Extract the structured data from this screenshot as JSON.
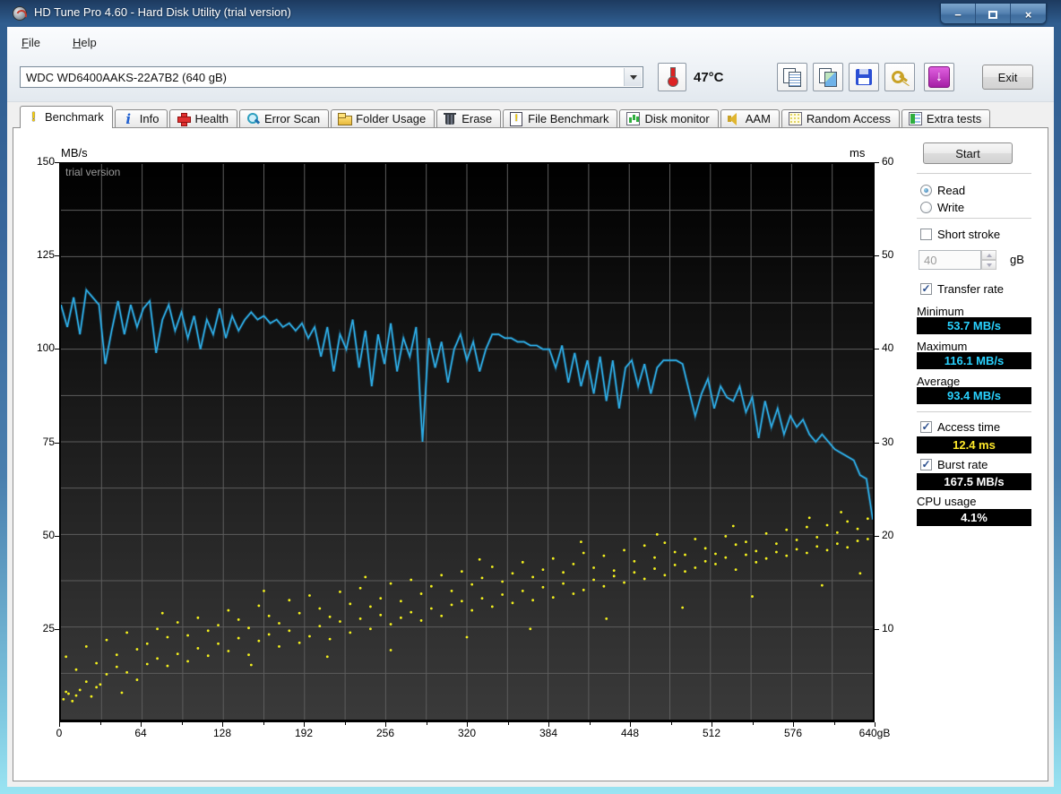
{
  "window": {
    "title": "HD Tune Pro 4.60 - Hard Disk Utility (trial version)",
    "minimize": "−",
    "close": "×"
  },
  "menu": {
    "items": [
      "File",
      "Help"
    ]
  },
  "toolbar": {
    "drive_selector": "WDC WD6400AAKS-22A7B2 (640 gB)",
    "temperature": "47°C",
    "exit_label": "Exit"
  },
  "tabs": [
    {
      "label": "Benchmark",
      "icon": "benchmark-icon",
      "active": true
    },
    {
      "label": "Info",
      "icon": "info-icon",
      "active": false
    },
    {
      "label": "Health",
      "icon": "health-icon",
      "active": false
    },
    {
      "label": "Error Scan",
      "icon": "error-scan-icon",
      "active": false
    },
    {
      "label": "Folder Usage",
      "icon": "folder-usage-icon",
      "active": false
    },
    {
      "label": "Erase",
      "icon": "erase-icon",
      "active": false
    },
    {
      "label": "File Benchmark",
      "icon": "file-benchmark-icon",
      "active": false
    },
    {
      "label": "Disk monitor",
      "icon": "disk-monitor-icon",
      "active": false
    },
    {
      "label": "AAM",
      "icon": "aam-icon",
      "active": false
    },
    {
      "label": "Random Access",
      "icon": "random-access-icon",
      "active": false
    },
    {
      "label": "Extra tests",
      "icon": "extra-tests-icon",
      "active": false
    }
  ],
  "benchmark": {
    "start_label": "Start",
    "read_label": "Read",
    "write_label": "Write",
    "selected_mode": "Read",
    "short_stroke": {
      "label": "Short stroke",
      "checked": false,
      "value": "40",
      "unit": "gB"
    },
    "transfer_rate": {
      "label": "Transfer rate",
      "checked": true,
      "minimum_label": "Minimum",
      "minimum": "53.7 MB/s",
      "maximum_label": "Maximum",
      "maximum": "116.1 MB/s",
      "average_label": "Average",
      "average": "93.4 MB/s"
    },
    "access_time": {
      "label": "Access time",
      "checked": true,
      "value": "12.4 ms"
    },
    "burst_rate": {
      "label": "Burst rate",
      "checked": true,
      "value": "167.5 MB/s"
    },
    "cpu_usage": {
      "label": "CPU usage",
      "value": "4.1%"
    }
  },
  "chart_data": {
    "type": "line",
    "watermark": "trial version",
    "left_axis": {
      "label": "MB/s",
      "range": [
        0,
        150
      ],
      "ticks": [
        150,
        125,
        100,
        75,
        50,
        25
      ],
      "grid_step": 12.5
    },
    "right_axis": {
      "label": "ms",
      "range": [
        0,
        60
      ],
      "ticks": [
        60,
        50,
        40,
        30,
        20,
        10
      ]
    },
    "x_axis": {
      "range": [
        0,
        640
      ],
      "ticks": [
        0,
        64,
        128,
        192,
        256,
        320,
        384,
        448,
        512,
        576,
        640
      ],
      "last_tick_suffix": "gB",
      "grid_step": 32
    },
    "series": [
      {
        "name": "transfer_rate",
        "type": "line",
        "axis": "left",
        "color": "#2da8e0",
        "x_start": 0,
        "x_step": 5,
        "values": [
          112,
          106,
          114,
          104,
          116,
          114,
          112,
          96,
          105,
          113,
          104,
          112,
          106,
          111,
          113,
          99,
          108,
          112,
          105,
          110,
          103,
          109,
          100,
          108,
          104,
          111,
          103,
          109,
          105,
          108,
          110,
          108,
          109,
          107,
          108,
          106,
          107,
          105,
          107,
          103,
          106,
          98,
          106,
          94,
          104,
          100,
          108,
          95,
          105,
          90,
          104,
          96,
          107,
          94,
          103,
          98,
          106,
          75,
          103,
          95,
          102,
          91,
          100,
          104,
          97,
          102,
          94,
          100,
          104,
          104,
          103,
          103,
          102,
          102,
          101,
          101,
          100,
          100,
          95,
          101,
          91,
          99,
          90,
          97,
          88,
          98,
          86,
          97,
          84,
          95,
          97,
          90,
          96,
          88,
          95,
          97,
          97,
          97,
          96,
          89,
          82,
          88,
          92,
          84,
          90,
          87,
          86,
          90,
          83,
          87,
          76,
          86,
          79,
          84,
          77,
          82,
          79,
          81,
          77,
          75,
          77,
          75,
          73,
          72,
          71,
          70,
          66,
          65,
          54
        ]
      },
      {
        "name": "access_time",
        "type": "scatter",
        "axis": "right",
        "color": "#f2ef1d",
        "points": [
          [
            2,
            2.2
          ],
          [
            4,
            6.8
          ],
          [
            4,
            3.0
          ],
          [
            6,
            2.8
          ],
          [
            9,
            2.0
          ],
          [
            12,
            5.4
          ],
          [
            12,
            2.6
          ],
          [
            15,
            3.2
          ],
          [
            20,
            7.9
          ],
          [
            20,
            4.1
          ],
          [
            24,
            2.5
          ],
          [
            28,
            6.1
          ],
          [
            28,
            3.5
          ],
          [
            31,
            3.8
          ],
          [
            36,
            8.6
          ],
          [
            36,
            4.9
          ],
          [
            44,
            7.0
          ],
          [
            44,
            5.7
          ],
          [
            48,
            2.9
          ],
          [
            52,
            9.4
          ],
          [
            52,
            5.1
          ],
          [
            60,
            7.6
          ],
          [
            60,
            4.3
          ],
          [
            68,
            8.2
          ],
          [
            68,
            6.0
          ],
          [
            76,
            9.8
          ],
          [
            76,
            6.6
          ],
          [
            80,
            11.5
          ],
          [
            84,
            8.9
          ],
          [
            84,
            5.8
          ],
          [
            92,
            10.5
          ],
          [
            92,
            7.1
          ],
          [
            100,
            9.1
          ],
          [
            100,
            6.3
          ],
          [
            108,
            11.0
          ],
          [
            108,
            7.7
          ],
          [
            116,
            9.6
          ],
          [
            116,
            6.9
          ],
          [
            124,
            10.2
          ],
          [
            124,
            8.2
          ],
          [
            132,
            11.8
          ],
          [
            132,
            7.4
          ],
          [
            140,
            10.8
          ],
          [
            140,
            8.8
          ],
          [
            148,
            9.9
          ],
          [
            148,
            7.0
          ],
          [
            150,
            5.9
          ],
          [
            156,
            12.3
          ],
          [
            156,
            8.5
          ],
          [
            160,
            13.9
          ],
          [
            164,
            11.2
          ],
          [
            164,
            9.2
          ],
          [
            172,
            10.4
          ],
          [
            172,
            7.9
          ],
          [
            180,
            12.9
          ],
          [
            180,
            9.6
          ],
          [
            188,
            11.5
          ],
          [
            188,
            8.3
          ],
          [
            196,
            13.4
          ],
          [
            196,
            9.0
          ],
          [
            204,
            12.0
          ],
          [
            204,
            10.1
          ],
          [
            210,
            6.8
          ],
          [
            212,
            11.1
          ],
          [
            212,
            8.7
          ],
          [
            220,
            13.8
          ],
          [
            220,
            10.6
          ],
          [
            228,
            12.5
          ],
          [
            228,
            9.4
          ],
          [
            236,
            14.2
          ],
          [
            236,
            10.9
          ],
          [
            240,
            15.4
          ],
          [
            244,
            12.2
          ],
          [
            244,
            9.8
          ],
          [
            252,
            13.1
          ],
          [
            252,
            11.3
          ],
          [
            260,
            14.7
          ],
          [
            260,
            10.3
          ],
          [
            260,
            7.5
          ],
          [
            268,
            12.8
          ],
          [
            268,
            11.0
          ],
          [
            276,
            15.1
          ],
          [
            276,
            11.6
          ],
          [
            284,
            13.6
          ],
          [
            284,
            10.7
          ],
          [
            292,
            14.4
          ],
          [
            292,
            12.0
          ],
          [
            300,
            15.6
          ],
          [
            300,
            11.2
          ],
          [
            308,
            13.9
          ],
          [
            308,
            12.4
          ],
          [
            316,
            16.0
          ],
          [
            316,
            12.8
          ],
          [
            320,
            8.9
          ],
          [
            324,
            14.6
          ],
          [
            324,
            11.8
          ],
          [
            330,
            17.3
          ],
          [
            332,
            15.3
          ],
          [
            332,
            13.1
          ],
          [
            340,
            16.5
          ],
          [
            340,
            12.2
          ],
          [
            348,
            14.9
          ],
          [
            348,
            13.5
          ],
          [
            356,
            15.8
          ],
          [
            356,
            12.6
          ],
          [
            364,
            17.0
          ],
          [
            364,
            13.9
          ],
          [
            370,
            9.8
          ],
          [
            372,
            15.4
          ],
          [
            372,
            12.9
          ],
          [
            380,
            16.2
          ],
          [
            380,
            14.3
          ],
          [
            388,
            17.4
          ],
          [
            388,
            13.2
          ],
          [
            396,
            15.9
          ],
          [
            396,
            14.7
          ],
          [
            404,
            16.8
          ],
          [
            404,
            13.6
          ],
          [
            410,
            19.2
          ],
          [
            412,
            18.0
          ],
          [
            412,
            14.0
          ],
          [
            420,
            16.4
          ],
          [
            420,
            15.1
          ],
          [
            428,
            17.7
          ],
          [
            428,
            14.4
          ],
          [
            430,
            10.9
          ],
          [
            436,
            16.1
          ],
          [
            436,
            15.5
          ],
          [
            444,
            18.3
          ],
          [
            444,
            14.8
          ],
          [
            452,
            17.1
          ],
          [
            452,
            15.9
          ],
          [
            460,
            18.8
          ],
          [
            460,
            15.2
          ],
          [
            468,
            17.5
          ],
          [
            468,
            16.3
          ],
          [
            470,
            20.0
          ],
          [
            476,
            19.1
          ],
          [
            476,
            15.6
          ],
          [
            484,
            18.1
          ],
          [
            484,
            16.7
          ],
          [
            490,
            12.1
          ],
          [
            492,
            17.8
          ],
          [
            492,
            16.0
          ],
          [
            500,
            19.5
          ],
          [
            500,
            16.4
          ],
          [
            508,
            18.5
          ],
          [
            508,
            17.1
          ],
          [
            516,
            17.9
          ],
          [
            516,
            16.8
          ],
          [
            524,
            19.8
          ],
          [
            524,
            17.5
          ],
          [
            530,
            20.9
          ],
          [
            532,
            18.9
          ],
          [
            532,
            16.2
          ],
          [
            540,
            19.2
          ],
          [
            540,
            17.8
          ],
          [
            545,
            13.3
          ],
          [
            548,
            18.2
          ],
          [
            548,
            17.0
          ],
          [
            556,
            20.1
          ],
          [
            556,
            17.4
          ],
          [
            564,
            19.0
          ],
          [
            564,
            18.1
          ],
          [
            572,
            20.5
          ],
          [
            572,
            17.7
          ],
          [
            580,
            19.4
          ],
          [
            580,
            18.4
          ],
          [
            588,
            20.8
          ],
          [
            588,
            18.0
          ],
          [
            590,
            21.8
          ],
          [
            596,
            19.7
          ],
          [
            596,
            18.7
          ],
          [
            600,
            14.5
          ],
          [
            604,
            21.0
          ],
          [
            604,
            18.3
          ],
          [
            612,
            20.2
          ],
          [
            612,
            19.0
          ],
          [
            615,
            22.4
          ],
          [
            620,
            21.4
          ],
          [
            620,
            18.6
          ],
          [
            628,
            20.6
          ],
          [
            628,
            19.3
          ],
          [
            630,
            15.8
          ],
          [
            636,
            21.7
          ],
          [
            636,
            19.5
          ]
        ]
      }
    ],
    "background": {
      "top": "#000000",
      "bottom": "#3a3a3a",
      "grid_color": "#5c5c5c"
    }
  }
}
